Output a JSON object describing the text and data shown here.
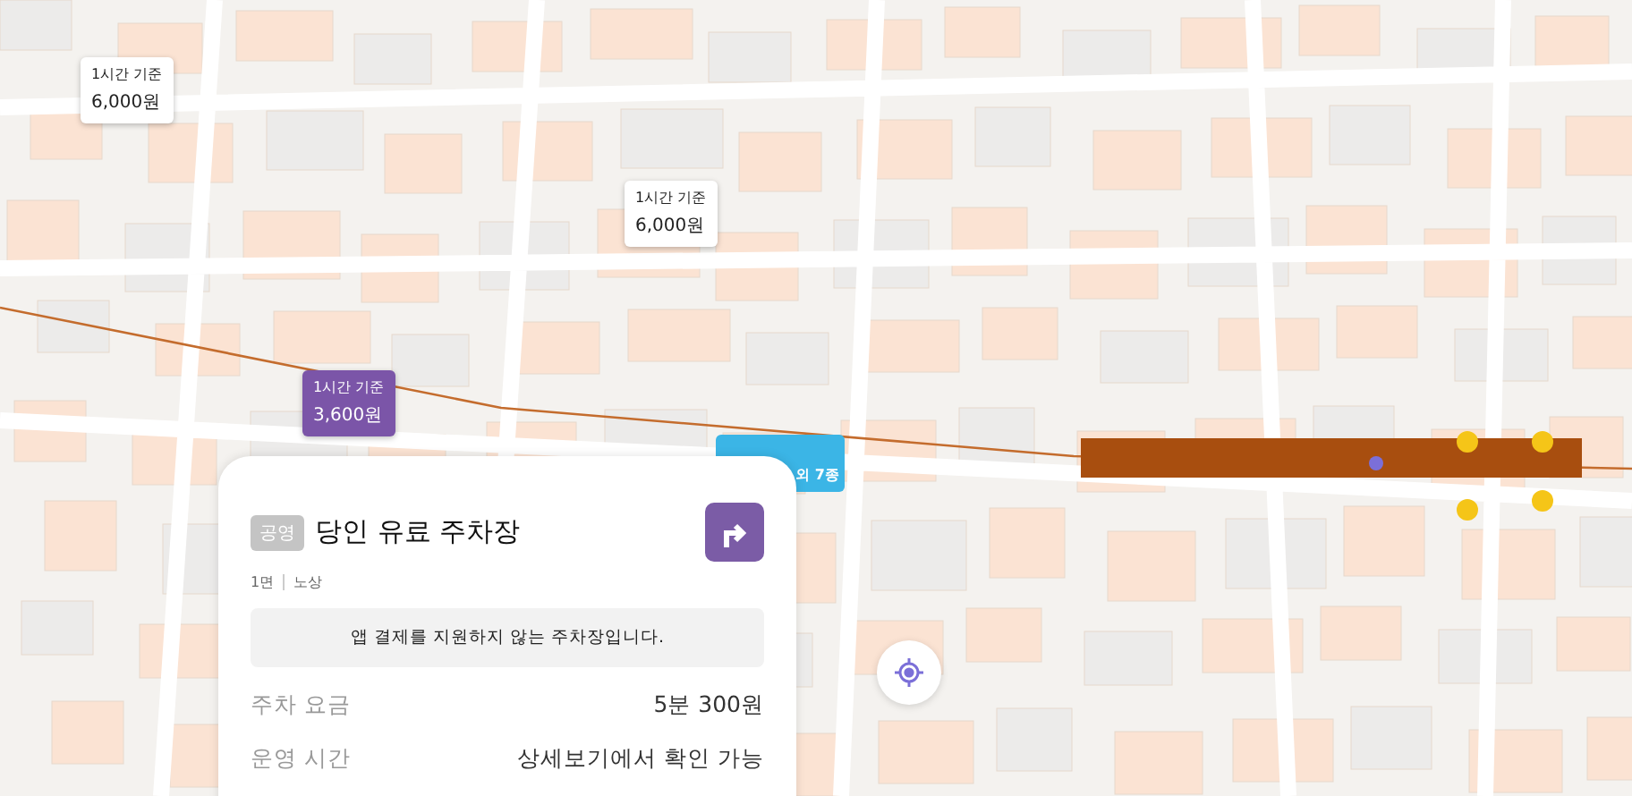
{
  "markers": [
    {
      "caption": "1시간 기준",
      "price": "6,000원",
      "selected": false
    },
    {
      "caption": "1시간 기준",
      "price": "6,000원",
      "selected": false
    },
    {
      "caption": "1시간 기준",
      "price": "3,600원",
      "selected": true
    }
  ],
  "partial_marker": {
    "text": "외 7종"
  },
  "card": {
    "tag": "공영",
    "title": "당인 유료 주차장",
    "meta": [
      "1면",
      "노상"
    ],
    "notice": "앱 결제를 지원하지 않는 주차장입니다.",
    "rows": [
      {
        "label": "주차 요금",
        "value": "5분 300원"
      },
      {
        "label": "운영 시간",
        "value": "상세보기에서 확인 가능"
      }
    ]
  }
}
